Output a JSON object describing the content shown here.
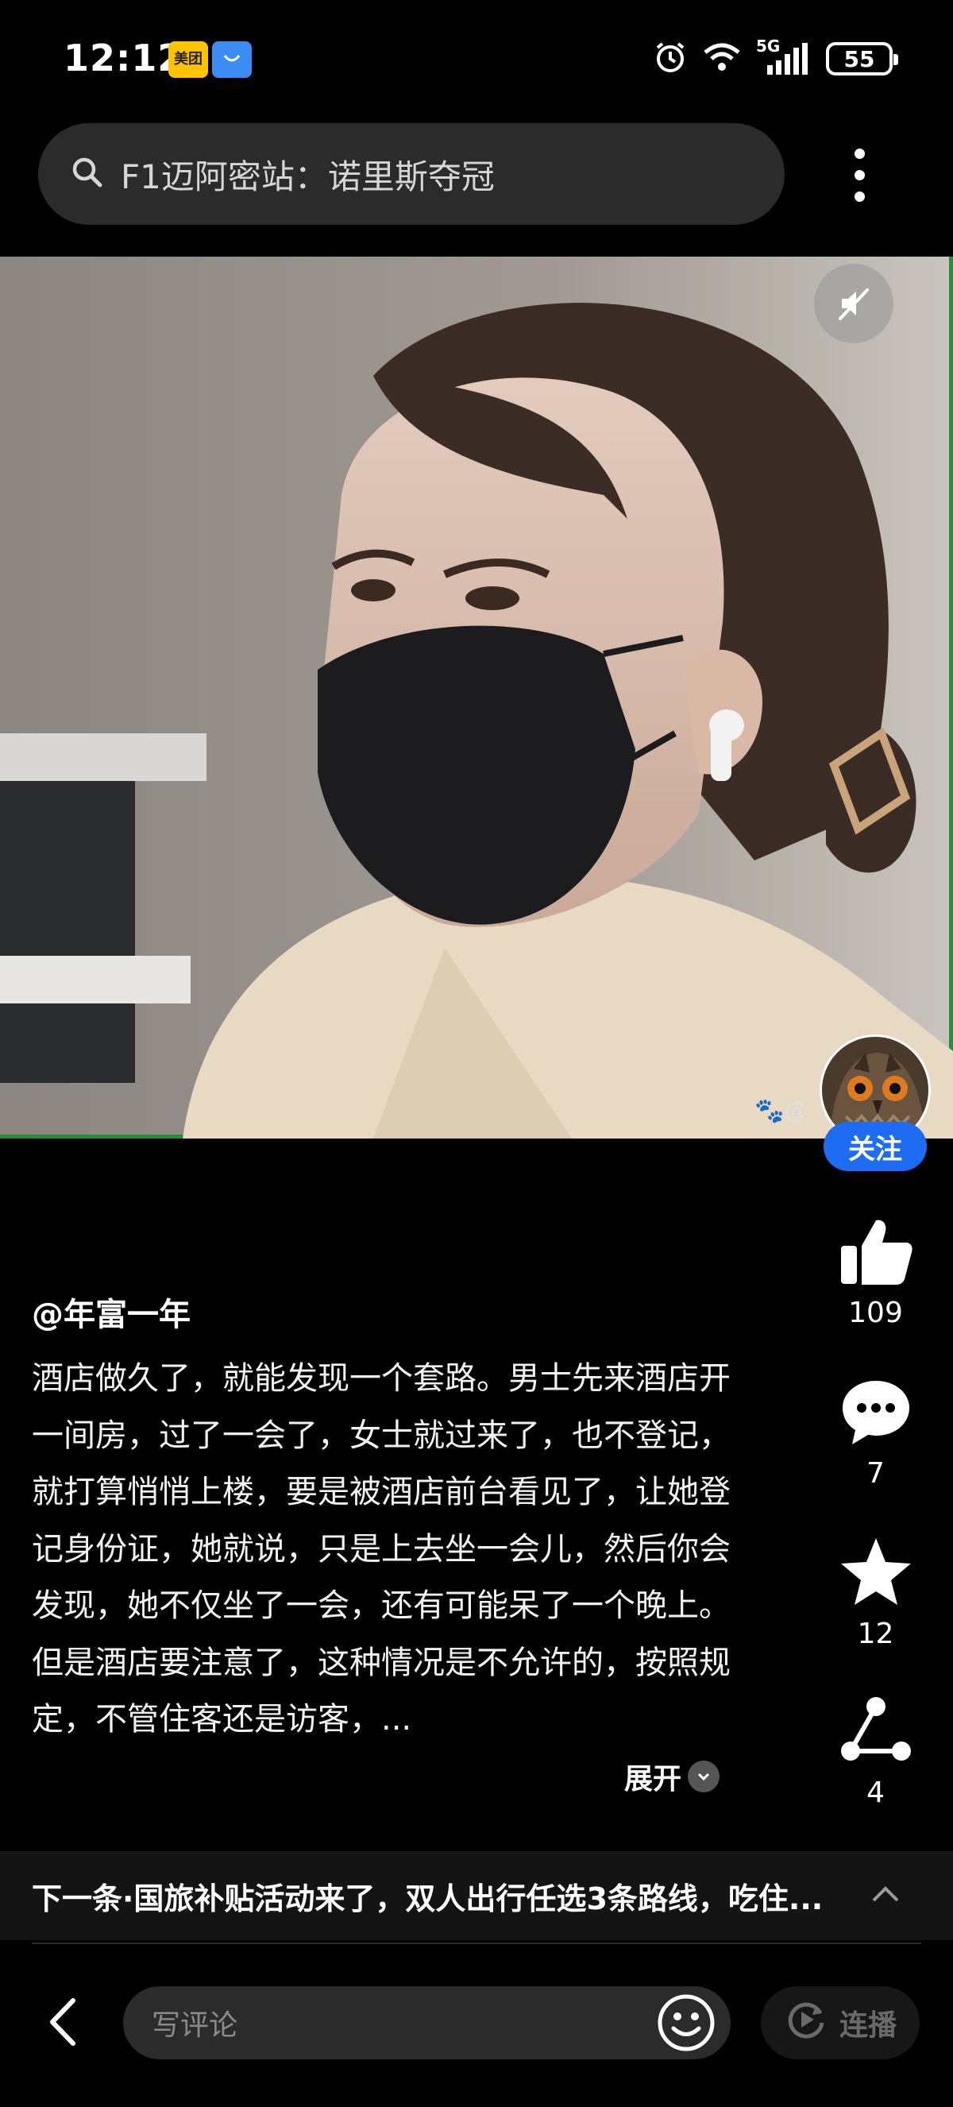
{
  "status_bar": {
    "time": "12:12",
    "app_badges": [
      "美团",
      "HONOR"
    ],
    "network": "5G",
    "battery": "55",
    "icons": [
      "alarm-icon",
      "wifi-icon",
      "signal-icon",
      "battery-icon"
    ]
  },
  "search": {
    "query": "F1迈阿密站：诺里斯夺冠",
    "icon": "search-icon"
  },
  "post": {
    "author": "@年富一年",
    "follow_label": "关注",
    "body": "酒店做久了，就能发现一个套路。男士先来酒店开一间房，过了一会了，女士就过来了，也不登记，就打算悄悄上楼，要是被酒店前台看见了，让她登记身份证，她就说，只是上去坐一会儿，然后你会发现，她不仅坐了一会，还有可能呆了一个晚上。但是酒店要注意了，这种情况是不允许的，按照规定，不管住客还是访客，...",
    "expand_label": "展开"
  },
  "actions": {
    "likes": "109",
    "comments": "7",
    "favorites": "12",
    "shares": "4"
  },
  "next": {
    "text": "下一条·国旅补贴活动来了，双人出行任选3条路线，吃住..."
  },
  "bottom": {
    "comment_placeholder": "写评论",
    "autoplay_label": "连播"
  },
  "colors": {
    "background": "#000000",
    "follow_button": "#1d6cf2",
    "input_bg": "#2b2b2b"
  }
}
